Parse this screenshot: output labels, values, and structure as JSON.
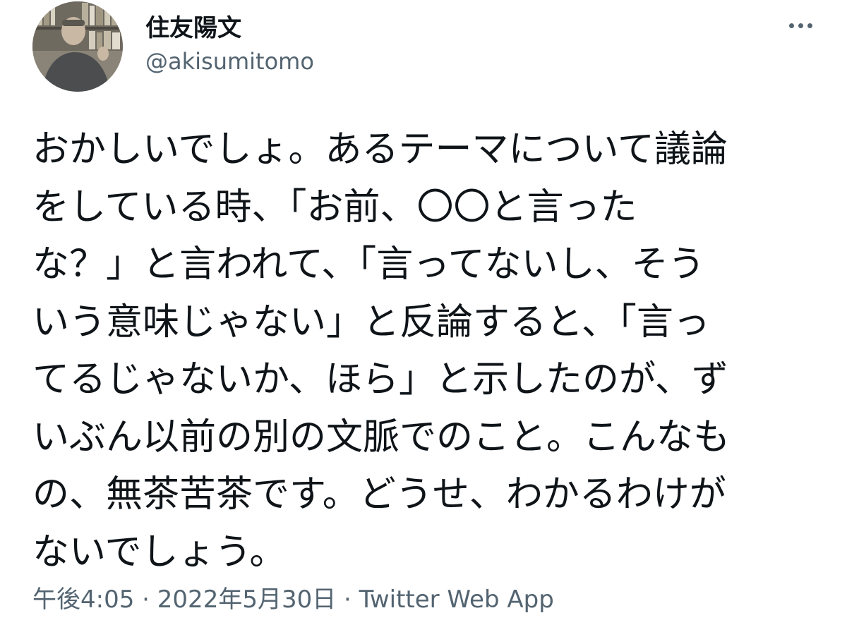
{
  "author": {
    "display_name": "住友陽文",
    "handle": "@akisumitomo"
  },
  "tweet": {
    "lines": [
      "おかしいでしょ。あるテーマについて議論",
      "をしている時、「お前、〇〇と言った",
      "な？」と言われて、「言ってないし、そう",
      "いう意味じゃない」と反論すると、「言っ",
      "てるじゃないか、ほら」と示したのが、ず",
      "いぶん以前の別の文脈でのこと。こんなも",
      "の、無茶苦茶です。どうせ、わかるわけが",
      "ないでしょう。"
    ]
  },
  "meta": {
    "time": "午後4:05",
    "separator": "·",
    "date": "2022年5月30日",
    "source": "Twitter Web App"
  },
  "icons": {
    "more": "more-horizontal-icon"
  },
  "colors": {
    "text_primary": "#0f1419",
    "text_secondary": "#536471",
    "background": "#ffffff"
  }
}
